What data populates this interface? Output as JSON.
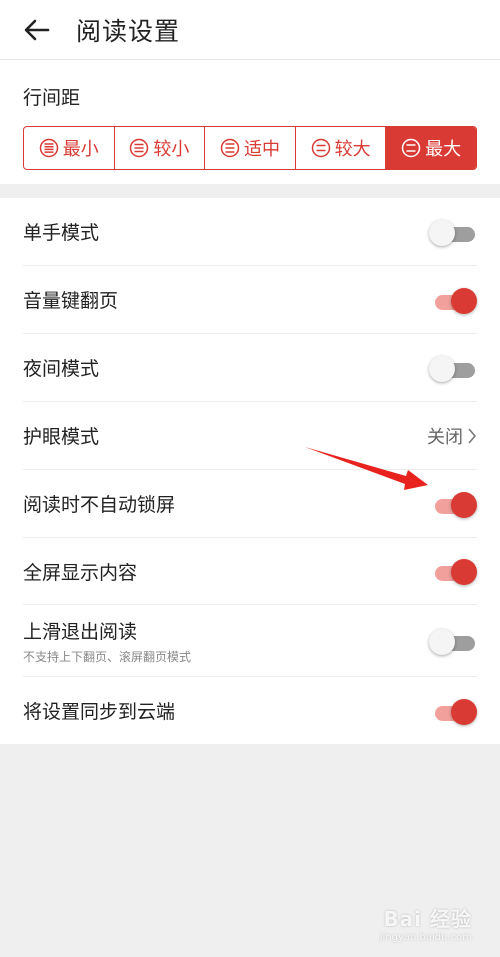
{
  "header": {
    "title": "阅读设置"
  },
  "line_spacing": {
    "label": "行间距",
    "options": [
      {
        "label": "最小",
        "active": false
      },
      {
        "label": "较小",
        "active": false
      },
      {
        "label": "适中",
        "active": false
      },
      {
        "label": "较大",
        "active": false
      },
      {
        "label": "最大",
        "active": true
      }
    ]
  },
  "settings": {
    "one_hand": {
      "label": "单手模式",
      "on": false
    },
    "volume_key": {
      "label": "音量键翻页",
      "on": true
    },
    "night_mode": {
      "label": "夜间模式",
      "on": false
    },
    "eye_care": {
      "label": "护眼模式",
      "value": "关闭"
    },
    "no_auto_lock": {
      "label": "阅读时不自动锁屏",
      "on": true
    },
    "fullscreen": {
      "label": "全屏显示内容",
      "on": true
    },
    "swipe_exit": {
      "label": "上滑退出阅读",
      "sub": "不支持上下翻页、滚屏翻页模式",
      "on": false
    },
    "sync_cloud": {
      "label": "将设置同步到云端",
      "on": true
    }
  },
  "watermark": {
    "main": "Bai 经验",
    "sub": "jingyan.baidu.com"
  },
  "colors": {
    "accent": "#d93a33",
    "annotation_arrow": "#e8231e"
  }
}
